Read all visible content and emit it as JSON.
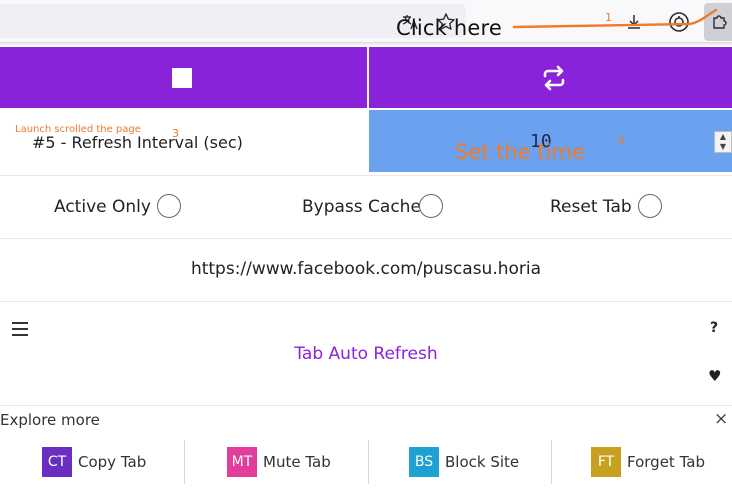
{
  "toolbar": {
    "translate_icon": "translate-icon",
    "bookmark_icon": "star-bookmark-icon",
    "download_icon": "download-icon",
    "account_icon": "account-icon",
    "extensions_icon": "puzzle-extensions-icon"
  },
  "annotations": {
    "click_here": "Click here",
    "step1": "1",
    "step2": "2",
    "step3": "3",
    "launch_note": "Launch scrolled the page",
    "set_time": "Set the time",
    "color": "#f07a2a"
  },
  "controls": {
    "stop_icon": "stop-square-icon",
    "repeat_icon": "repeat-icon",
    "accent": "#8a22d9"
  },
  "interval": {
    "label": "#5 - Refresh Interval (sec)",
    "value": "10",
    "field_color": "#6ba2f0"
  },
  "options": [
    {
      "label": "Active Only"
    },
    {
      "label": "Bypass Cache"
    },
    {
      "label": "Reset Tab"
    }
  ],
  "tab_url": "https://www.facebook.com/puscasu.horia",
  "footer": {
    "title": "Tab Auto Refresh",
    "help": "?",
    "heart": "♥",
    "menu_icon": "hamburger-menu-icon"
  },
  "explore": {
    "title": "Explore more",
    "close": "×",
    "items": [
      {
        "badge": "CT",
        "name": "Copy Tab",
        "color": "#6a2fc0"
      },
      {
        "badge": "MT",
        "name": "Mute Tab",
        "color": "#e13d9a"
      },
      {
        "badge": "BS",
        "name": "Block Site",
        "color": "#1ea0d2"
      },
      {
        "badge": "FT",
        "name": "Forget Tab",
        "color": "#c6a01e"
      }
    ]
  }
}
